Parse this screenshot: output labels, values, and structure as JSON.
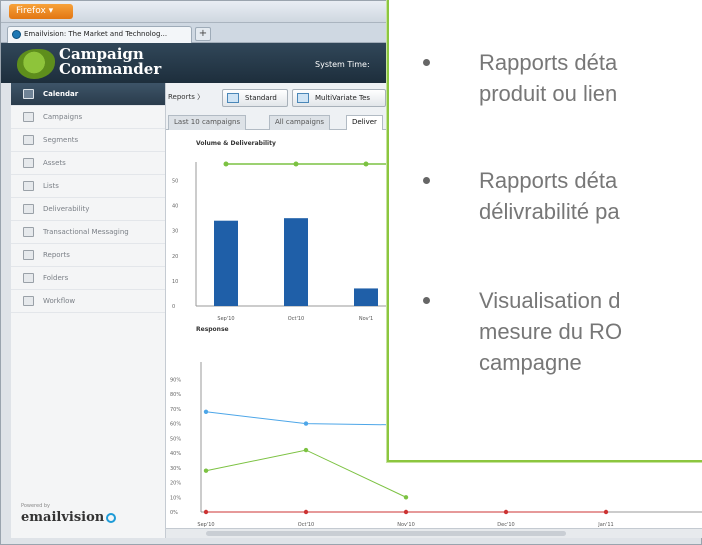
{
  "browser": {
    "menu_label": "Firefox ▾",
    "tab_title": "Emailvision: The Market and Technolog...",
    "newtab_label": "+"
  },
  "app": {
    "logo_line1": "Campaign",
    "logo_line2": "Commander",
    "system_time_label": "System Time:",
    "powered_by": "Powered by",
    "brand": "emailvision"
  },
  "sidebar": {
    "items": [
      {
        "label": "Calendar",
        "icon": "calendar-icon",
        "active": true
      },
      {
        "label": "Campaigns",
        "icon": "campaigns-icon"
      },
      {
        "label": "Segments",
        "icon": "segments-icon"
      },
      {
        "label": "Assets",
        "icon": "assets-icon"
      },
      {
        "label": "Lists",
        "icon": "lists-icon"
      },
      {
        "label": "Deliverability",
        "icon": "deliverability-icon"
      },
      {
        "label": "Transactional Messaging",
        "icon": "transactional-icon"
      },
      {
        "label": "Reports",
        "icon": "reports-icon"
      },
      {
        "label": "Folders",
        "icon": "folders-icon"
      },
      {
        "label": "Workflow",
        "icon": "workflow-icon"
      }
    ]
  },
  "toolbar": {
    "breadcrumb": "Reports",
    "separator": "〉",
    "standard_label": "Standard",
    "multivariate_label": "MultiVariate Tes"
  },
  "subtabs": [
    "Last 10 campaigns",
    "All campaigns",
    "Deliver"
  ],
  "chart_data": [
    {
      "type": "bar",
      "title": "Volume & Deliverability",
      "categories": [
        "Sep'10",
        "Oct'10",
        "Nov'1"
      ],
      "values": [
        34,
        35,
        7
      ],
      "ylim": [
        0,
        55
      ],
      "yticks": [
        "0",
        "10",
        "20",
        "30",
        "40",
        "50"
      ],
      "top_line_series": [
        {
          "name": "",
          "values": [
            57,
            57,
            57
          ]
        }
      ],
      "color": "#1f5fa8"
    },
    {
      "type": "line",
      "title": "Response",
      "categories": [
        "Sep'10",
        "Oct'10",
        "Nov'10",
        "Dec'10",
        "Jan'11"
      ],
      "yticks": [
        "0%",
        "10%",
        "20%",
        "30%",
        "40%",
        "50%",
        "60%",
        "70%",
        "80%",
        "90%"
      ],
      "ylim": [
        0,
        95
      ],
      "series": [
        {
          "name": "",
          "color": "#4da6e8",
          "values": [
            68,
            60,
            59
          ]
        },
        {
          "name": "",
          "color": "#7cc242",
          "values": [
            28,
            42,
            10
          ]
        },
        {
          "name": "",
          "color": "#cc3333",
          "values": [
            0,
            0,
            0,
            0,
            0
          ]
        }
      ]
    }
  ],
  "overlay": {
    "bullets": [
      {
        "line1": "Rapports déta",
        "line2": "produit ou lien"
      },
      {
        "line1": "Rapports déta",
        "line2": "délivrabilité pa"
      },
      {
        "line1": "Visualisation d",
        "line2": "mesure du RO",
        "line3": "campagne"
      }
    ]
  }
}
